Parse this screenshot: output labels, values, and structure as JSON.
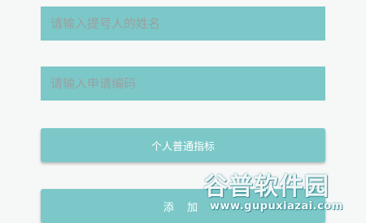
{
  "form": {
    "name_placeholder": "请输入提号人的姓名",
    "code_placeholder": "请输入申请编码",
    "name_value": "",
    "code_value": ""
  },
  "buttons": {
    "indicator_label": "个人普通指标",
    "add_label": "添 加"
  },
  "watermark": {
    "title": "谷普软件园",
    "url": "www.gupuxiazai.com"
  },
  "colors": {
    "field_background": "#7cc8c8",
    "page_background": "#f6f7f7",
    "button_text": "#ffffff"
  }
}
